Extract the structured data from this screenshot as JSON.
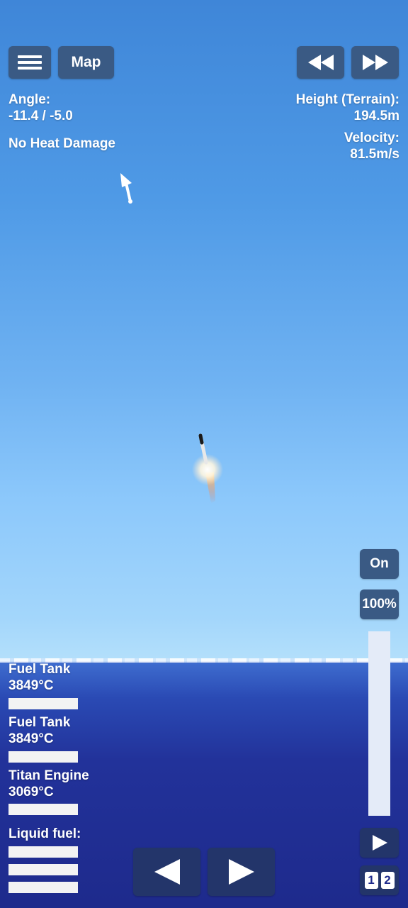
{
  "top_bar": {
    "map_label": "Map"
  },
  "telemetry": {
    "angle_label": "Angle:",
    "angle_value": "-11.4 / -5.0",
    "heat_status": "No Heat Damage",
    "height_label": "Height (Terrain):",
    "height_value": "194.5m",
    "velocity_label": "Velocity:",
    "velocity_value": "81.5m/s"
  },
  "controls": {
    "throttle_toggle": "On",
    "throttle_percent": "100%",
    "throttle_level": 1.0,
    "stage_badge_1": "1",
    "stage_badge_2": "2"
  },
  "parts": [
    {
      "name": "Fuel Tank",
      "temp": "3849°C"
    },
    {
      "name": "Fuel Tank",
      "temp": "3849°C"
    },
    {
      "name": "Titan Engine",
      "temp": "3069°C"
    }
  ],
  "resources": {
    "liquid_fuel_label": "Liquid fuel:"
  },
  "icons": {
    "menu": "hamburger-icon",
    "rewind": "rewind-icon",
    "fast_forward": "fast-forward-icon",
    "rotate_left": "triangle-left-icon",
    "rotate_right": "triangle-right-icon",
    "stage": "play-icon",
    "prograde_marker": "arrow-icon"
  },
  "colors": {
    "button": "#3a5a84",
    "button_dark": "#23356a",
    "sea": "#1e2a8c",
    "sky_top": "#3f86d8",
    "sky_horizon": "#b4e0fb"
  }
}
